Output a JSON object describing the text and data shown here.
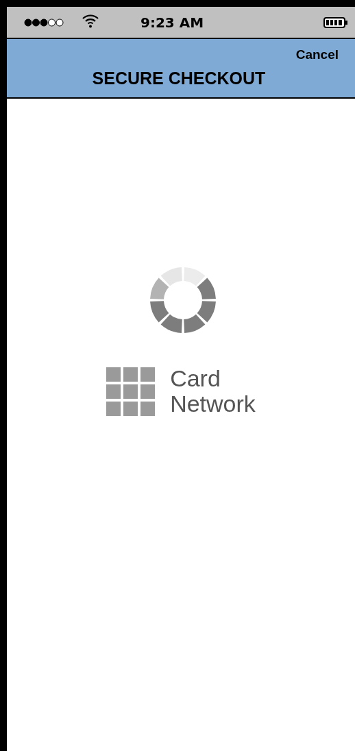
{
  "status_bar": {
    "time": "9:23 AM"
  },
  "header": {
    "title": "SECURE CHECKOUT",
    "cancel": "Cancel"
  },
  "logo": {
    "lines": [
      "Card",
      "Network"
    ]
  }
}
